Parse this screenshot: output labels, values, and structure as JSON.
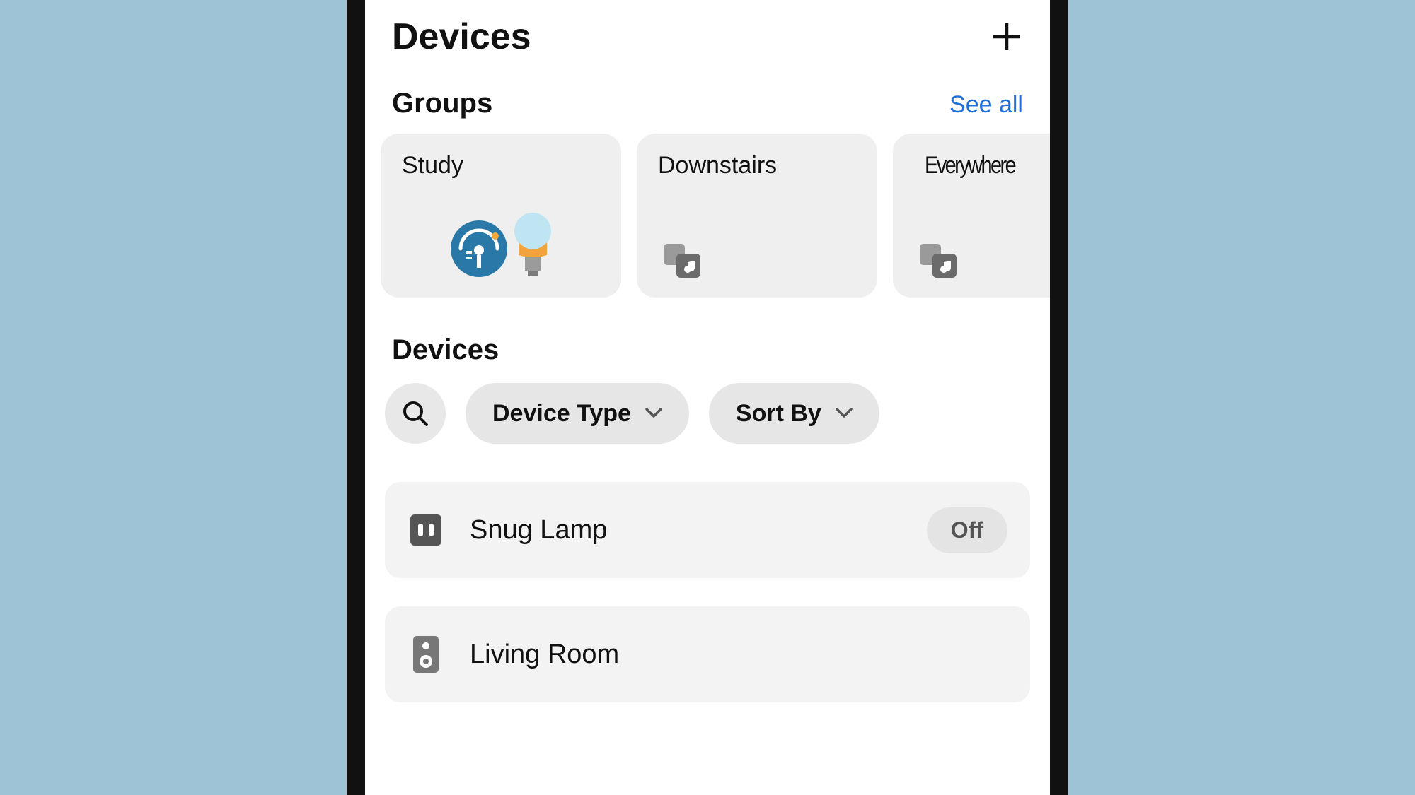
{
  "header": {
    "title": "Devices"
  },
  "groups": {
    "title": "Groups",
    "see_all": "See all",
    "items": [
      {
        "name": "Study"
      },
      {
        "name": "Downstairs"
      },
      {
        "name": "Everywhere"
      }
    ]
  },
  "devices_section": {
    "title": "Devices"
  },
  "filters": {
    "device_type": "Device Type",
    "sort_by": "Sort By"
  },
  "devices": [
    {
      "name": "Snug Lamp",
      "state": "Off",
      "icon": "plug"
    },
    {
      "name": "Living Room",
      "state": "",
      "icon": "speaker"
    }
  ]
}
